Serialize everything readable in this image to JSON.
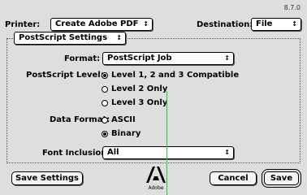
{
  "version": "8.7.0",
  "printer": {
    "label": "Printer:",
    "value": "Create Adobe PDF"
  },
  "destination": {
    "label": "Destination:",
    "value": "File"
  },
  "panel_selector": {
    "value": "PostScript Settings"
  },
  "format": {
    "label": "Format:",
    "value": "PostScript Job"
  },
  "postscript_level": {
    "label": "PostScript Level:",
    "options": [
      "Level 1, 2 and 3 Compatible",
      "Level 2 Only",
      "Level 3 Only"
    ],
    "selected_index": 0
  },
  "data_format": {
    "label": "Data Format:",
    "options": [
      "ASCII",
      "Binary"
    ],
    "selected_index": 1
  },
  "font_inclusion": {
    "label": "Font Inclusion:",
    "value": "All"
  },
  "buttons": {
    "save_settings": "Save Settings",
    "cancel": "Cancel",
    "save": "Save"
  },
  "logo": {
    "text": "Adobe"
  },
  "colors": {
    "background": "#dedede",
    "guide_line": "#31c431"
  }
}
